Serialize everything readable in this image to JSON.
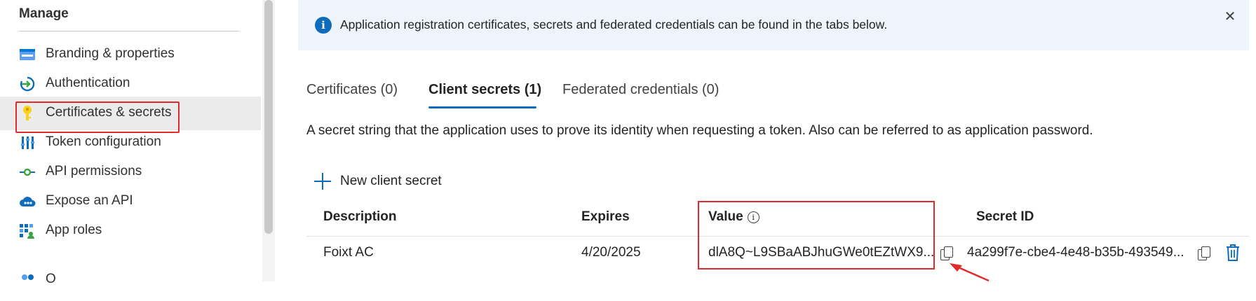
{
  "sidebar": {
    "section_title": "Manage",
    "items": [
      {
        "label": "Branding & properties",
        "icon": "branding-icon"
      },
      {
        "label": "Authentication",
        "icon": "authentication-icon"
      },
      {
        "label": "Certificates & secrets",
        "icon": "key-icon",
        "selected": true
      },
      {
        "label": "Token configuration",
        "icon": "token-configuration-icon"
      },
      {
        "label": "API permissions",
        "icon": "api-permissions-icon"
      },
      {
        "label": "Expose an API",
        "icon": "cloud-icon"
      },
      {
        "label": "App roles",
        "icon": "app-roles-icon"
      },
      {
        "label": "O",
        "icon": "people-icon"
      }
    ]
  },
  "banner": {
    "text": "Application registration certificates, secrets and federated credentials can be found in the tabs below.",
    "icon": "info-icon",
    "close_icon": "close-icon"
  },
  "tabs": [
    {
      "label": "Certificates (0)"
    },
    {
      "label": "Client secrets (1)",
      "active": true
    },
    {
      "label": "Federated credentials (0)"
    }
  ],
  "description": "A secret string that the application uses to prove its identity when requesting a token. Also can be referred to as application password.",
  "new_secret_label": "New client secret",
  "table": {
    "headers": [
      "Description",
      "Expires",
      "Value",
      "Secret ID"
    ],
    "rows": [
      {
        "description": "Foixt AC",
        "expires": "4/20/2025",
        "value": "dlA8Q~L9SBaABJhuGWe0tEZtWX9...",
        "secret_id": "4a299f7e-cbe4-4e48-b35b-493549..."
      }
    ]
  },
  "colors": {
    "accent": "#0f6cbd",
    "highlight": "#e02b2b",
    "banner_bg": "#edf4fc"
  }
}
